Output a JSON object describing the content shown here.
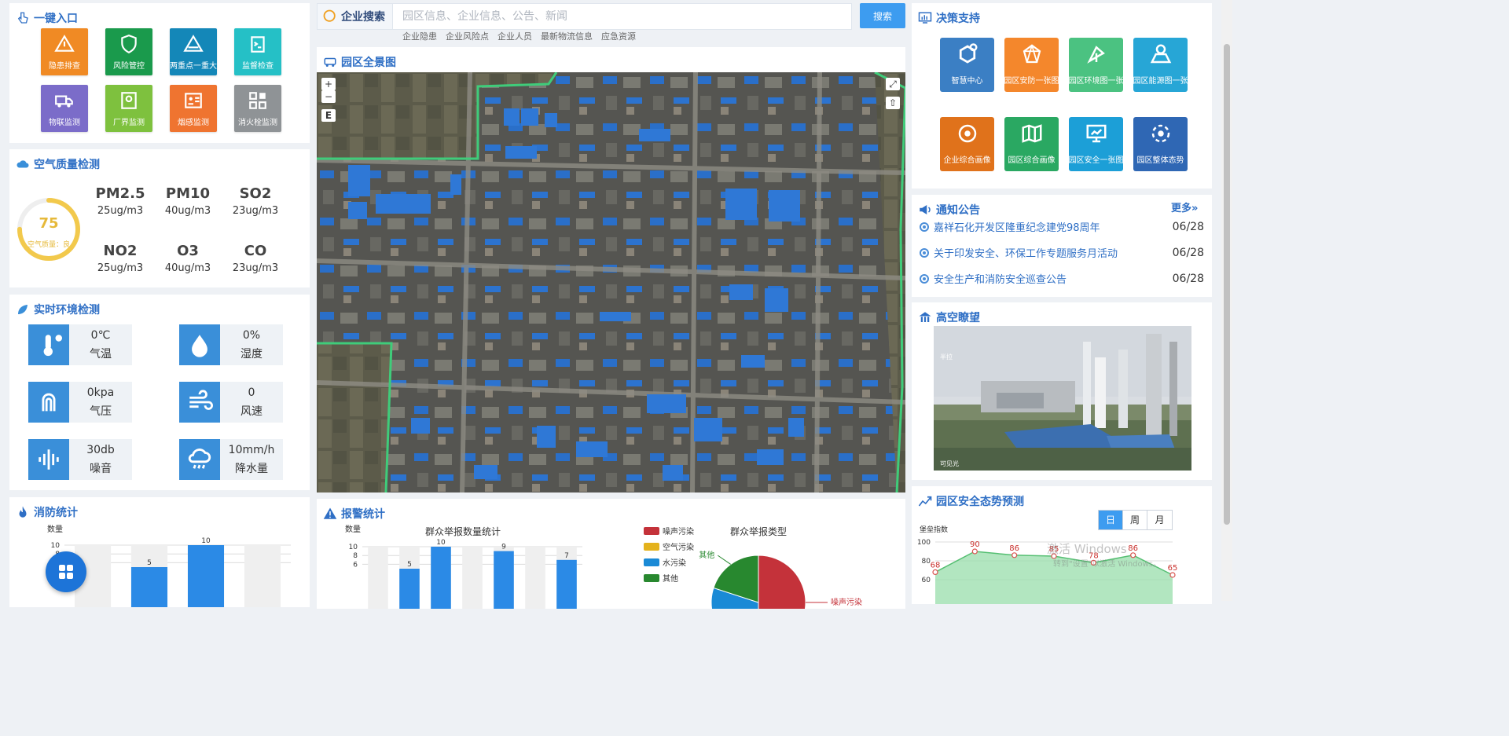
{
  "quick_entry": {
    "title": "一键入口",
    "items": [
      {
        "label": "隐患排查",
        "color": "#f08a24",
        "icon": "warning-icon"
      },
      {
        "label": "风险管控",
        "color": "#1a9a4c",
        "icon": "shield-icon"
      },
      {
        "label": "两重点一重大",
        "color": "#1487b8",
        "icon": "hazard-icon"
      },
      {
        "label": "监督检查",
        "color": "#25c0c6",
        "icon": "clipboard-icon"
      },
      {
        "label": "物联监测",
        "color": "#7b6cc9",
        "icon": "truck-icon"
      },
      {
        "label": "厂界监测",
        "color": "#7ec13e",
        "icon": "monitor-icon"
      },
      {
        "label": "烟感监测",
        "color": "#ef7430",
        "icon": "smoke-icon"
      },
      {
        "label": "消火栓监测",
        "color": "#8f9396",
        "icon": "grid-icon"
      }
    ]
  },
  "air_quality": {
    "title": "空气质量检测",
    "aqi": "75",
    "aqi_fraction": 0.75,
    "quality_label": "空气质量：良",
    "items": [
      {
        "name": "PM2.5",
        "value": "25ug/m3"
      },
      {
        "name": "PM10",
        "value": "40ug/m3"
      },
      {
        "name": "SO2",
        "value": "23ug/m3"
      },
      {
        "name": "NO2",
        "value": "25ug/m3"
      },
      {
        "name": "O3",
        "value": "40ug/m3"
      },
      {
        "name": "CO",
        "value": "23ug/m3"
      }
    ]
  },
  "environment": {
    "title": "实时环境检测",
    "items": [
      {
        "value": "0℃",
        "label": "气温",
        "icon": "thermometer-icon"
      },
      {
        "value": "0%",
        "label": "湿度",
        "icon": "humidity-icon"
      },
      {
        "value": "0kpa",
        "label": "气压",
        "icon": "pressure-icon"
      },
      {
        "value": "0",
        "label": "风速",
        "icon": "wind-icon"
      },
      {
        "value": "30db",
        "label": "噪音",
        "icon": "noise-icon"
      },
      {
        "value": "10mm/h",
        "label": "降水量",
        "icon": "rain-icon"
      }
    ]
  },
  "fire_stats": {
    "title": "消防统计"
  },
  "search": {
    "label": "企业搜索",
    "placeholder": "园区信息、企业信息、公告、新闻",
    "button": "搜索",
    "tags": [
      "企业隐患",
      "企业风险点",
      "企业人员",
      "最新物流信息",
      "应急资源"
    ]
  },
  "map": {
    "title": "园区全景图",
    "zoom_in": "+",
    "zoom_out": "−",
    "layer_btn": "E",
    "fullscreen": "⤢",
    "home": "⇧"
  },
  "alarm_stats": {
    "title": "报警统计"
  },
  "decision": {
    "title": "决策支持",
    "items": [
      {
        "label": "智慧中心",
        "color": "#3b7fc4",
        "icon": "hexagon-icon"
      },
      {
        "label": "园区安防一张图",
        "color": "#f4872c",
        "icon": "network-icon"
      },
      {
        "label": "园区环境图一张",
        "color": "#4bc281",
        "icon": "plant-icon"
      },
      {
        "label": "园区能源图一张",
        "color": "#27a6d6",
        "icon": "map-pin-icon"
      },
      {
        "label": "企业综合画像",
        "color": "#e0721b",
        "icon": "target-icon"
      },
      {
        "label": "园区综合画像",
        "color": "#2aa862",
        "icon": "map-icon"
      },
      {
        "label": "园区安全一张图",
        "color": "#1c9fd7",
        "icon": "screen-icon"
      },
      {
        "label": "园区整体态势",
        "color": "#2f67b4",
        "icon": "radar-icon"
      }
    ]
  },
  "notice": {
    "title": "通知公告",
    "more": "更多»",
    "items": [
      {
        "text": "嘉祥石化开发区隆重纪念建党98周年",
        "date": "06/28"
      },
      {
        "text": "关于印发安全、环保工作专题服务月活动",
        "date": "06/28"
      },
      {
        "text": "安全生产和消防安全巡查公告",
        "date": "06/28"
      }
    ]
  },
  "high_view": {
    "title": "高空瞭望",
    "caption": "可见光",
    "overlay_left": "半拉"
  },
  "safety_trend": {
    "title": "园区安全态势预测",
    "tabs": [
      "日",
      "周",
      "月"
    ],
    "active_tab": "日"
  },
  "watermark": {
    "line1": "激活 Windows",
    "line2": "转到\"设置\"以激活 Windows。"
  },
  "chart_data": [
    {
      "id": "fire",
      "type": "bar",
      "ylabel": "数量",
      "ylim": [
        0,
        10
      ],
      "yticks": [
        6,
        8,
        10
      ],
      "values": [
        null,
        5,
        10,
        null
      ],
      "labels": [
        "",
        "5",
        "10",
        ""
      ]
    },
    {
      "id": "report-count",
      "type": "bar",
      "title": "群众举报数量统计",
      "ylabel": "数量",
      "ylim": [
        0,
        10
      ],
      "yticks": [
        6,
        8,
        10
      ],
      "values": [
        null,
        5,
        10,
        null,
        9,
        null,
        7
      ],
      "labels": [
        "",
        "5",
        "10",
        "",
        "9",
        "",
        "7"
      ]
    },
    {
      "id": "report-type",
      "type": "pie",
      "title": "群众举报类型",
      "series": [
        {
          "name": "噪声污染",
          "value": 50,
          "color": "#c4323a"
        },
        {
          "name": "空气污染",
          "value": 0,
          "color": "#e4b21c"
        },
        {
          "name": "水污染",
          "value": 30,
          "color": "#1a8ad6"
        },
        {
          "name": "其他",
          "value": 20,
          "color": "#28882f"
        }
      ]
    },
    {
      "id": "safety-index",
      "type": "area",
      "ylabel": "堡垒指数",
      "ylim": [
        60,
        100
      ],
      "yticks": [
        60,
        80,
        100
      ],
      "values": [
        68,
        90,
        86,
        85,
        78,
        86,
        65
      ],
      "labels": [
        "68",
        "90",
        "86",
        "85",
        "78",
        "86",
        "65"
      ]
    }
  ]
}
